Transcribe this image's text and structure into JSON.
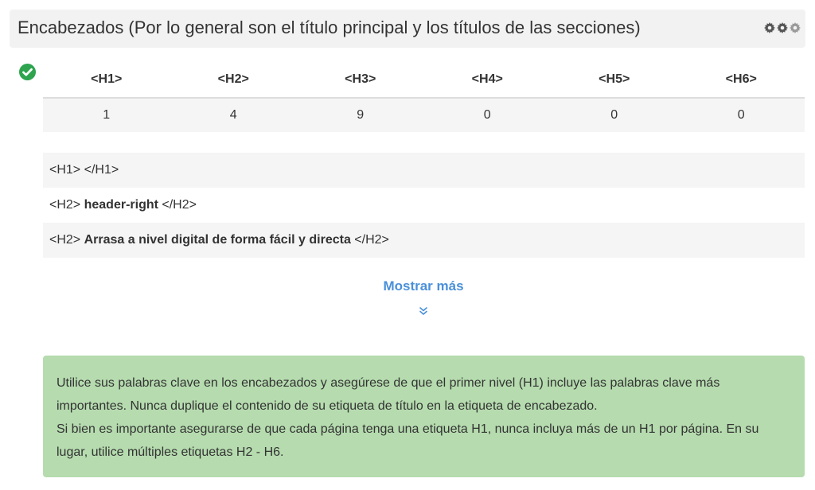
{
  "header": {
    "title": "Encabezados (Por lo general son el título principal y los títulos de las secciones)"
  },
  "status": {
    "icon": "check-circle-icon",
    "color": "#2ea44f"
  },
  "counts": {
    "headers": [
      "<H1>",
      "<H2>",
      "<H3>",
      "<H4>",
      "<H5>",
      "<H6>"
    ],
    "values": [
      "1",
      "4",
      "9",
      "0",
      "0",
      "0"
    ]
  },
  "headings": [
    {
      "open": "<H1>",
      "text": "",
      "close": "</H1>"
    },
    {
      "open": "<H2>",
      "text": "header-right",
      "close": "</H2>"
    },
    {
      "open": "<H2>",
      "text": "Arrasa a nivel digital de forma fácil y directa",
      "close": "</H2>"
    }
  ],
  "show_more": {
    "label": "Mostrar más",
    "icon": "double-chevron-down-icon"
  },
  "advice": {
    "line1": "Utilice sus palabras clave en los encabezados y asegúrese de que el primer nivel (H1) incluye las palabras clave más importantes. Nunca duplique el contenido de su etiqueta de título en la etiqueta de encabezado.",
    "line2": "Si bien es importante asegurarse de que cada página tenga una etiqueta H1, nunca incluya más de un H1 por página. En su lugar, utilice múltiples etiquetas H2 - H6."
  },
  "colors": {
    "accent": "#4a90d9",
    "advice_bg": "#b5dbae",
    "success": "#2ea44f"
  }
}
